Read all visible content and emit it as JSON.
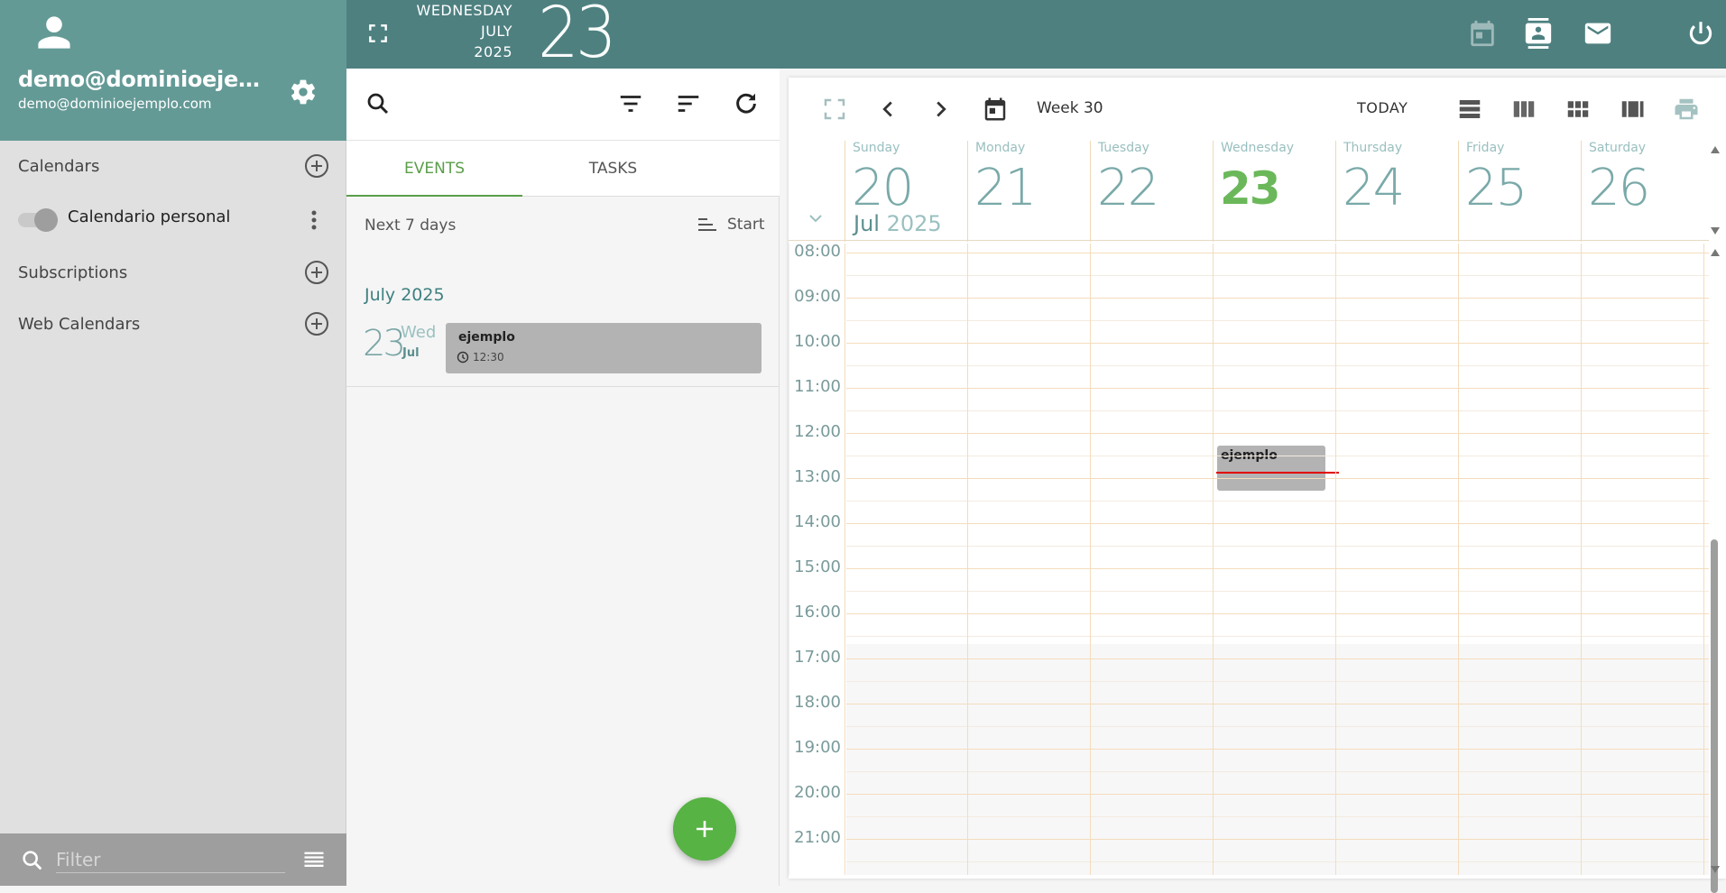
{
  "user": {
    "name": "demo@dominioejemplo.com",
    "email": "demo@dominioejemplo.com"
  },
  "sidebar": {
    "calendars_label": "Calendars",
    "calendar_items": [
      {
        "name": "Calendario personal",
        "enabled": true
      }
    ],
    "subscriptions_label": "Subscriptions",
    "web_calendars_label": "Web Calendars",
    "filter_placeholder": "Filter"
  },
  "header": {
    "weekday": "WEDNESDAY",
    "month": "JULY",
    "year": "2025",
    "day": "23"
  },
  "list_panel": {
    "tabs": [
      {
        "label": "EVENTS",
        "active": true
      },
      {
        "label": "TASKS",
        "active": false
      }
    ],
    "range_label": "Next 7 days",
    "sort_label": "Start",
    "month_heading": "July 2025",
    "events": [
      {
        "day": "23",
        "weekday": "Wed",
        "month": "Jul",
        "title": "ejemplo",
        "time": "12:30"
      }
    ]
  },
  "calendar": {
    "week_label": "Week 30",
    "today_label": "TODAY",
    "month": "Jul",
    "year": "2025",
    "days": [
      {
        "name": "Sunday",
        "num": "20",
        "today": false
      },
      {
        "name": "Monday",
        "num": "21",
        "today": false
      },
      {
        "name": "Tuesday",
        "num": "22",
        "today": false
      },
      {
        "name": "Wednesday",
        "num": "23",
        "today": true
      },
      {
        "name": "Thursday",
        "num": "24",
        "today": false
      },
      {
        "name": "Friday",
        "num": "25",
        "today": false
      },
      {
        "name": "Saturday",
        "num": "26",
        "today": false
      }
    ],
    "hours": [
      "08:00",
      "09:00",
      "10:00",
      "11:00",
      "12:00",
      "13:00",
      "14:00",
      "15:00",
      "16:00",
      "17:00",
      "18:00",
      "19:00",
      "20:00",
      "21:00"
    ],
    "events": [
      {
        "title": "ejemplo",
        "day": "Wednesday",
        "start": "12:30"
      }
    ],
    "current_time_marker": "Wednesday"
  },
  "colors": {
    "header_bg": "#4e8080",
    "profile_bg": "#649a96",
    "accent_green": "#57b344",
    "now_line": "#e10000",
    "event_bg": "#b3b3b3"
  },
  "icons": {
    "topbar": [
      "fullscreen-icon",
      "calendar-icon",
      "contacts-icon",
      "mail-icon",
      "power-icon"
    ],
    "list_toolbar": [
      "search-icon",
      "filter-icon",
      "sort-icon",
      "refresh-icon"
    ],
    "calendar_toolbar": [
      "fullscreen-icon",
      "chevron-left-icon",
      "chevron-right-icon",
      "date-picker-icon",
      "day-view-icon",
      "week-view-icon",
      "month-view-icon",
      "multi-column-view-icon",
      "print-icon"
    ]
  }
}
